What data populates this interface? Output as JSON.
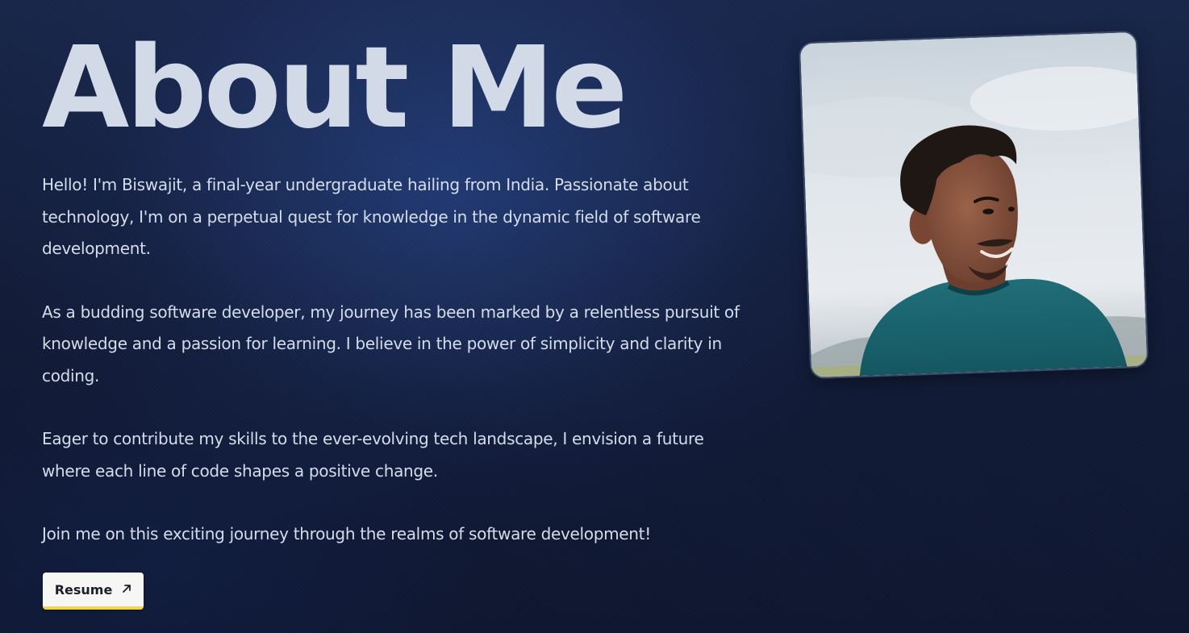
{
  "heading": "About Me",
  "paragraphs": [
    "Hello! I'm Biswajit, a final-year undergraduate hailing from India. Passionate about technology, I'm on a perpetual quest for knowledge in the dynamic field of software development.",
    "As a budding software developer, my journey has been marked by a relentless pursuit of knowledge and a passion for learning. I believe in the power of simplicity and clarity in coding.",
    "Eager to contribute my skills to the ever-evolving tech landscape, I envision a future where each line of code shapes a positive change.",
    "Join me on this exciting journey through the realms of software development!"
  ],
  "resume_button": {
    "label": "Resume",
    "icon": "arrow-up-right-icon"
  },
  "colors": {
    "background": "#121c38",
    "heading": "#d2dae8",
    "text": "#d5dcea",
    "button_bg": "#f6f6f4",
    "button_accent": "#f2d548"
  }
}
